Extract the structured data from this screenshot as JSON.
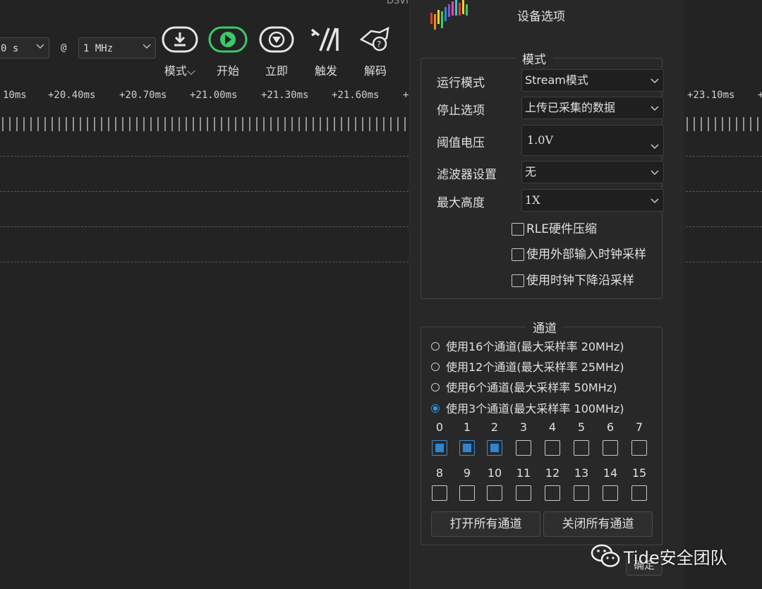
{
  "app": {
    "title_fragment": "DSVI"
  },
  "toolbar": {
    "duration_value": "0 s",
    "at_symbol": "@",
    "rate_value": "1 MHz",
    "buttons": [
      {
        "label": "模式⌵",
        "icon": "download-icon"
      },
      {
        "label": "开始",
        "icon": "play-icon"
      },
      {
        "label": "立即",
        "icon": "instant-icon"
      },
      {
        "label": "触发",
        "icon": "trigger-icon"
      },
      {
        "label": "解码",
        "icon": "decode-icon"
      }
    ]
  },
  "ruler": {
    "labels": [
      "10ms",
      "+20.40ms",
      "+20.70ms",
      "+21.00ms",
      "+21.30ms",
      "+21.60ms",
      "+",
      "+23.10ms",
      "+"
    ]
  },
  "dialog": {
    "title": "设备选项",
    "mode_group": {
      "title": "模式",
      "run_mode_label": "运行模式",
      "run_mode_value": "Stream模式",
      "stop_label": "停止选项",
      "stop_value": "上传已采集的数据",
      "threshold_label": "阈值电压",
      "threshold_value": "1.0V",
      "filter_label": "滤波器设置",
      "filter_value": "无",
      "height_label": "最大高度",
      "height_value": "1X",
      "checkboxes": [
        "RLE硬件压缩",
        "使用外部输入时钟采样",
        "使用时钟下降沿采样"
      ]
    },
    "channel_group": {
      "title": "通道",
      "options": [
        {
          "label": "使用16个通道(最大采样率 20MHz)",
          "selected": false
        },
        {
          "label": "使用12个通道(最大采样率 25MHz)",
          "selected": false
        },
        {
          "label": "使用6个通道(最大采样率 50MHz)",
          "selected": false
        },
        {
          "label": "使用3个通道(最大采样率 100MHz)",
          "selected": true
        }
      ],
      "channels_row1": [
        "0",
        "1",
        "2",
        "3",
        "4",
        "5",
        "6",
        "7"
      ],
      "channels_row2": [
        "8",
        "9",
        "10",
        "11",
        "12",
        "13",
        "14",
        "15"
      ],
      "enabled_channels": [
        "0",
        "1",
        "2"
      ],
      "open_all_label": "打开所有通道",
      "close_all_label": "关闭所有通道"
    },
    "ok_label": "确定"
  },
  "watermark": {
    "text": "Tide安全团队"
  },
  "colors": {
    "accent_blue": "#2f86d0",
    "start_green": "#3cc96a",
    "arrow_red": "#e0392b"
  }
}
